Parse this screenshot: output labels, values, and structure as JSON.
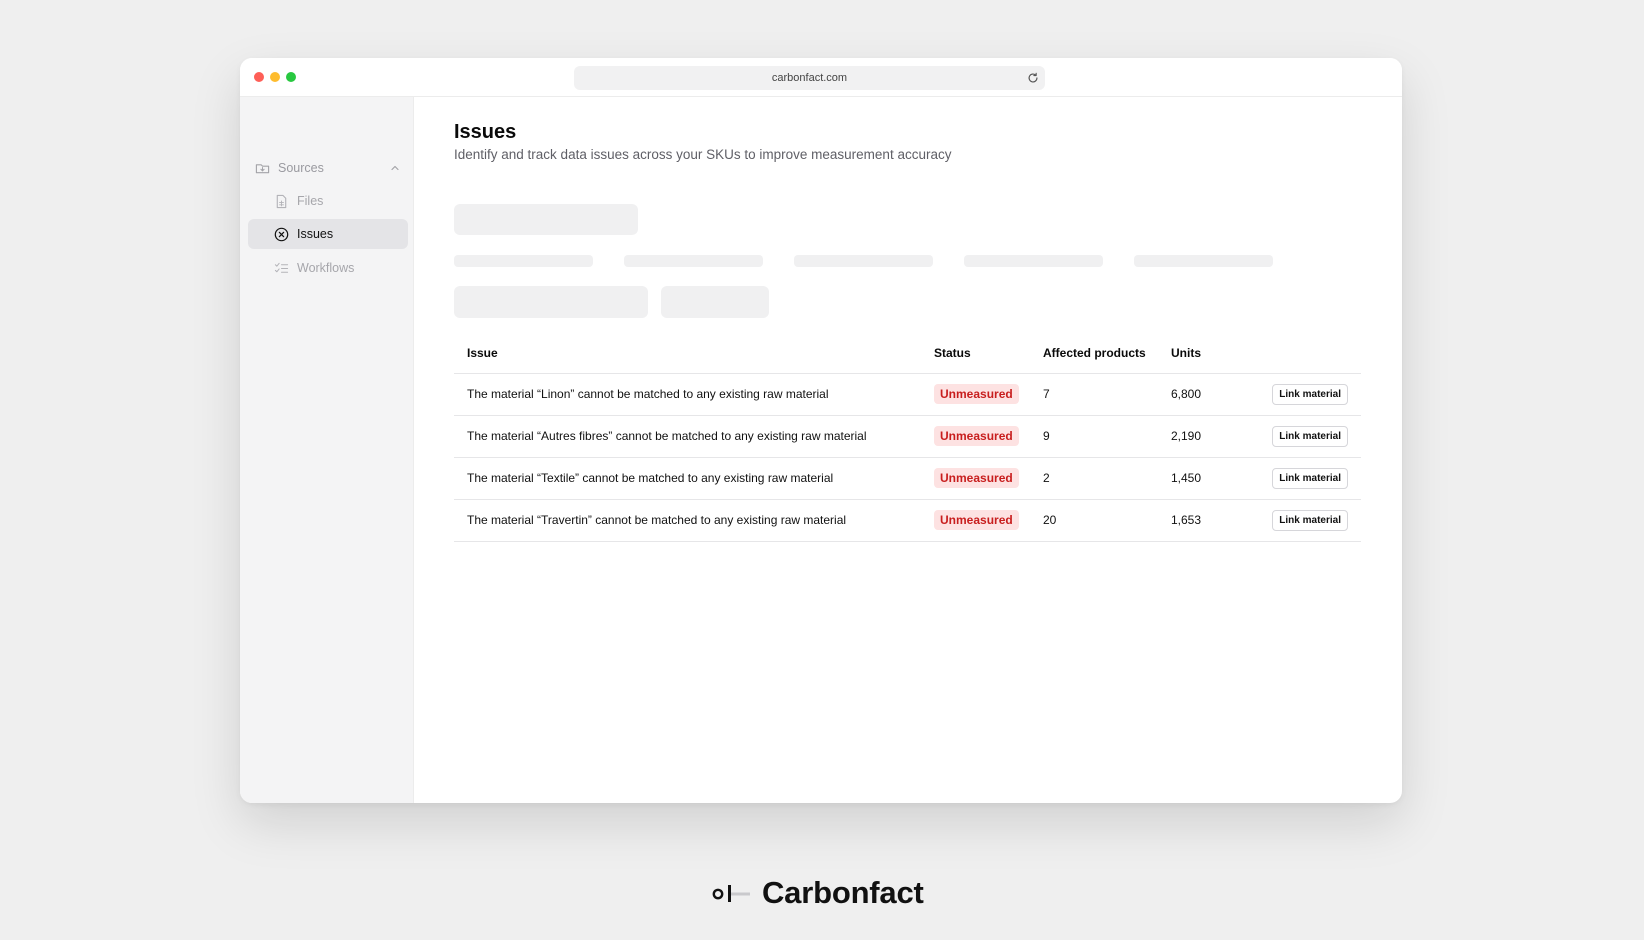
{
  "browser": {
    "url": "carbonfact.com"
  },
  "sidebar": {
    "section": {
      "label": "Sources",
      "icon": "folder-icon"
    },
    "items": [
      {
        "label": "Files",
        "icon": "file-icon",
        "active": false
      },
      {
        "label": "Issues",
        "icon": "circle-x-icon",
        "active": true
      },
      {
        "label": "Workflows",
        "icon": "checklist-icon",
        "active": false
      }
    ]
  },
  "page": {
    "title": "Issues",
    "subtitle": "Identify and track data issues across your SKUs to improve measurement accuracy"
  },
  "table": {
    "headers": {
      "issue": "Issue",
      "status": "Status",
      "affected": "Affected products",
      "units": "Units"
    },
    "rows": [
      {
        "issue": "The material “Linon” cannot be matched to any existing raw material",
        "status": "Unmeasured",
        "affected": "7",
        "units": "6,800",
        "action": "Link material"
      },
      {
        "issue": "The material “Autres fibres” cannot be matched to any existing raw material",
        "status": "Unmeasured",
        "affected": "9",
        "units": "2,190",
        "action": "Link material"
      },
      {
        "issue": "The material “Textile” cannot be matched to any existing raw material",
        "status": "Unmeasured",
        "affected": "2",
        "units": "1,450",
        "action": "Link material"
      },
      {
        "issue": "The material “Travertin” cannot be matched to any existing raw material",
        "status": "Unmeasured",
        "affected": "20",
        "units": "1,653",
        "action": "Link material"
      }
    ]
  },
  "brand": {
    "name": "Carbonfact"
  },
  "colors": {
    "status_bg": "#fde2e2",
    "status_text": "#c81e1e",
    "sidebar_active": "#e4e4e7"
  }
}
